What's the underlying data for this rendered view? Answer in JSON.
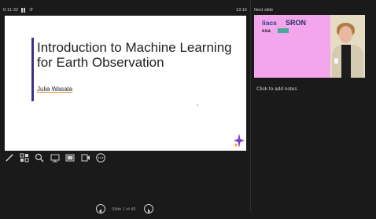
{
  "presenter": {
    "elapsed_time": "0:11:32",
    "reset_icon": "↺",
    "clock": "13:16"
  },
  "slide": {
    "title": "Introduction to Machine Learning for Earth Observation",
    "author": "Julia Wasala",
    "cursor_glyph": "ᵇ"
  },
  "tools": [
    "pen-icon",
    "slides-grid-icon",
    "magnifier-icon",
    "laser-pointer-icon",
    "black-screen-icon",
    "camera-icon",
    "more-options-icon"
  ],
  "next_slide": {
    "label": "Next slide",
    "logo_liacs": "liacs",
    "logo_sron": "SRON",
    "logo_esa": "esa"
  },
  "notes": {
    "placeholder": "Click to add notes"
  },
  "navigation": {
    "slide_counter": "Slide 1 of 45"
  },
  "colors": {
    "background": "#1a1a1a",
    "slide_accent": "#3a2f8f",
    "next_slide_bg": "#f3a6ec"
  }
}
